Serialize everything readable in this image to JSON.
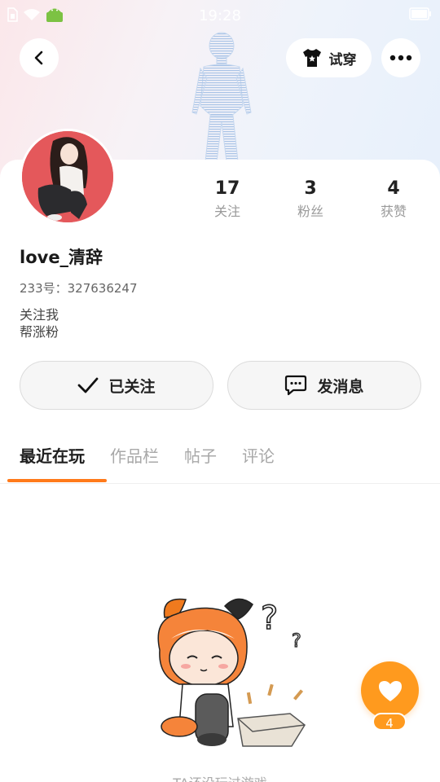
{
  "status_bar": {
    "time": "19:28"
  },
  "header": {
    "try_on_label": "试穿"
  },
  "profile": {
    "username": "love_清辞",
    "user_id": "233号：327636247",
    "bio_lines": [
      "关注我",
      "帮涨粉"
    ]
  },
  "stats": [
    {
      "value": "17",
      "label": "关注"
    },
    {
      "value": "3",
      "label": "粉丝"
    },
    {
      "value": "4",
      "label": "获赞"
    }
  ],
  "actions": {
    "follow_label": "已关注",
    "message_label": "发消息"
  },
  "tabs": [
    {
      "label": "最近在玩",
      "active": true
    },
    {
      "label": "作品栏",
      "active": false
    },
    {
      "label": "帖子",
      "active": false
    },
    {
      "label": "评论",
      "active": false
    }
  ],
  "empty_state": {
    "text": "TA还没玩过游戏"
  },
  "like_button": {
    "count": "4"
  },
  "colors": {
    "accent": "#ff7a1a",
    "fab": "#ff9a1e",
    "avatar_bg": "#e4585b"
  }
}
